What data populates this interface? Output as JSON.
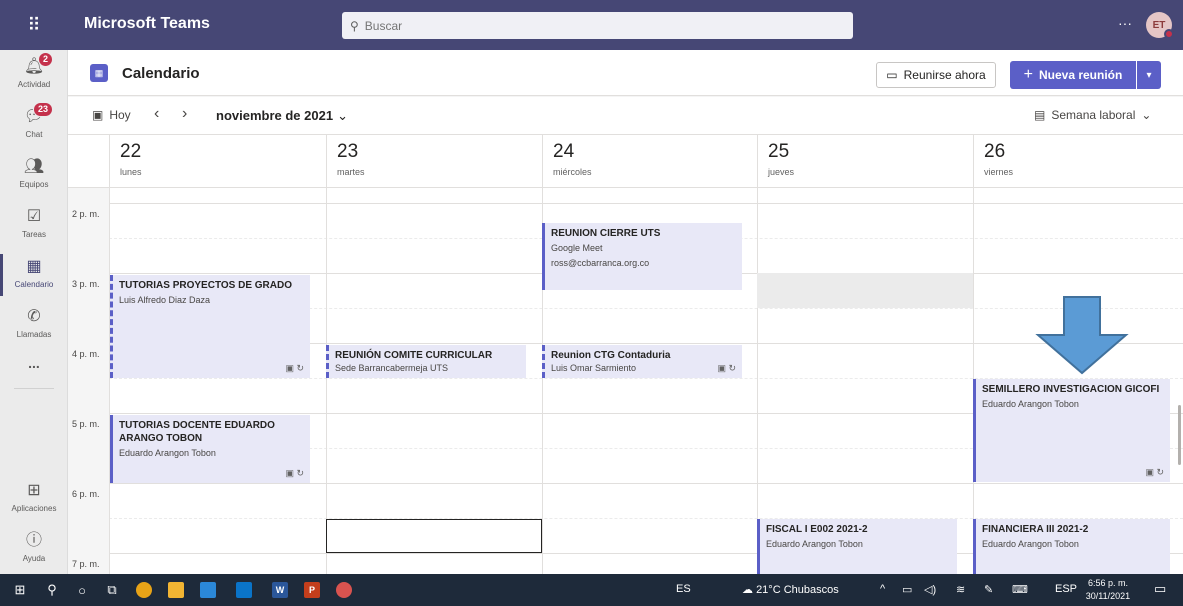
{
  "app": {
    "title": "Microsoft Teams",
    "user_initials": "ET"
  },
  "search": {
    "placeholder": "Buscar"
  },
  "rail": {
    "items": [
      {
        "label": "Actividad",
        "badge": "2"
      },
      {
        "label": "Chat",
        "badge": "23"
      },
      {
        "label": "Equipos"
      },
      {
        "label": "Tareas"
      },
      {
        "label": "Calendario"
      },
      {
        "label": "Llamadas"
      },
      {
        "label": "..."
      },
      {
        "label": "Aplicaciones"
      },
      {
        "label": "Ayuda"
      }
    ]
  },
  "header": {
    "title": "Calendario",
    "meet_now": "Reunirse ahora",
    "new_meeting": "Nueva reunión"
  },
  "toolbar": {
    "today": "Hoy",
    "month": "noviembre de 2021",
    "view": "Semana laboral"
  },
  "days": [
    {
      "num": "22",
      "name": "lunes"
    },
    {
      "num": "23",
      "name": "martes"
    },
    {
      "num": "24",
      "name": "miércoles"
    },
    {
      "num": "25",
      "name": "jueves"
    },
    {
      "num": "26",
      "name": "viernes"
    }
  ],
  "times": [
    "2 p. m.",
    "3 p. m.",
    "4 p. m.",
    "5 p. m.",
    "6 p. m.",
    "7 p. m."
  ],
  "events": [
    {
      "title": "REUNION CIERRE UTS",
      "line1": "Google Meet",
      "line2": "ross@ccbarranca.org.co"
    },
    {
      "title": "TUTORIAS PROYECTOS DE GRADO",
      "line1": "Luis Alfredo Diaz Daza"
    },
    {
      "title": "REUNIÓN COMITE CURRICULAR",
      "line1": "Sede Barrancabermeja UTS"
    },
    {
      "title": "Reunion CTG Contaduria",
      "line1": "Luis Omar Sarmiento"
    },
    {
      "title": "SEMILLERO INVESTIGACION GICOFI",
      "line1": "Eduardo Arangon Tobon"
    },
    {
      "title": "TUTORIAS DOCENTE EDUARDO ARANGO TOBON",
      "line1": "Eduardo Arangon Tobon"
    },
    {
      "title": "FISCAL I E002 2021-2",
      "line1": "Eduardo Arangon Tobon"
    },
    {
      "title": "FINANCIERA III 2021-2",
      "line1": "Eduardo Arangon Tobon"
    }
  ],
  "taskbar": {
    "lang": "ES",
    "weather": "21°C Chubascos",
    "input_lang": "ESP",
    "time": "6:56 p. m.",
    "date": "30/11/2021"
  },
  "colors": {
    "header": "#464775",
    "accent": "#5b5fc7",
    "event_bg": "#e8e8f7",
    "arrow": "#5b9bd5"
  }
}
